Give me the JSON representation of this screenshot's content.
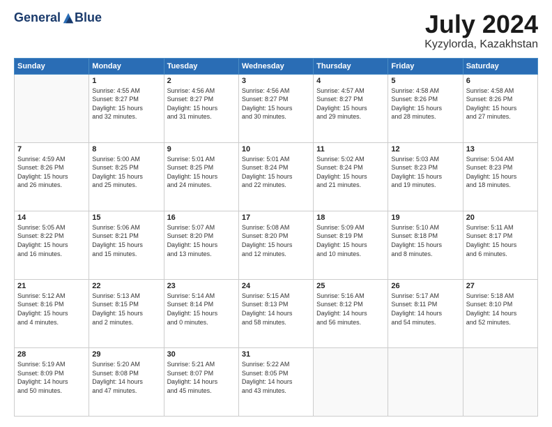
{
  "header": {
    "logo_general": "General",
    "logo_blue": "Blue",
    "title": "July 2024",
    "location": "Kyzylorda, Kazakhstan"
  },
  "days_of_week": [
    "Sunday",
    "Monday",
    "Tuesday",
    "Wednesday",
    "Thursday",
    "Friday",
    "Saturday"
  ],
  "weeks": [
    [
      {
        "day": "",
        "text": ""
      },
      {
        "day": "1",
        "text": "Sunrise: 4:55 AM\nSunset: 8:27 PM\nDaylight: 15 hours\nand 32 minutes."
      },
      {
        "day": "2",
        "text": "Sunrise: 4:56 AM\nSunset: 8:27 PM\nDaylight: 15 hours\nand 31 minutes."
      },
      {
        "day": "3",
        "text": "Sunrise: 4:56 AM\nSunset: 8:27 PM\nDaylight: 15 hours\nand 30 minutes."
      },
      {
        "day": "4",
        "text": "Sunrise: 4:57 AM\nSunset: 8:27 PM\nDaylight: 15 hours\nand 29 minutes."
      },
      {
        "day": "5",
        "text": "Sunrise: 4:58 AM\nSunset: 8:26 PM\nDaylight: 15 hours\nand 28 minutes."
      },
      {
        "day": "6",
        "text": "Sunrise: 4:58 AM\nSunset: 8:26 PM\nDaylight: 15 hours\nand 27 minutes."
      }
    ],
    [
      {
        "day": "7",
        "text": "Sunrise: 4:59 AM\nSunset: 8:26 PM\nDaylight: 15 hours\nand 26 minutes."
      },
      {
        "day": "8",
        "text": "Sunrise: 5:00 AM\nSunset: 8:25 PM\nDaylight: 15 hours\nand 25 minutes."
      },
      {
        "day": "9",
        "text": "Sunrise: 5:01 AM\nSunset: 8:25 PM\nDaylight: 15 hours\nand 24 minutes."
      },
      {
        "day": "10",
        "text": "Sunrise: 5:01 AM\nSunset: 8:24 PM\nDaylight: 15 hours\nand 22 minutes."
      },
      {
        "day": "11",
        "text": "Sunrise: 5:02 AM\nSunset: 8:24 PM\nDaylight: 15 hours\nand 21 minutes."
      },
      {
        "day": "12",
        "text": "Sunrise: 5:03 AM\nSunset: 8:23 PM\nDaylight: 15 hours\nand 19 minutes."
      },
      {
        "day": "13",
        "text": "Sunrise: 5:04 AM\nSunset: 8:23 PM\nDaylight: 15 hours\nand 18 minutes."
      }
    ],
    [
      {
        "day": "14",
        "text": "Sunrise: 5:05 AM\nSunset: 8:22 PM\nDaylight: 15 hours\nand 16 minutes."
      },
      {
        "day": "15",
        "text": "Sunrise: 5:06 AM\nSunset: 8:21 PM\nDaylight: 15 hours\nand 15 minutes."
      },
      {
        "day": "16",
        "text": "Sunrise: 5:07 AM\nSunset: 8:20 PM\nDaylight: 15 hours\nand 13 minutes."
      },
      {
        "day": "17",
        "text": "Sunrise: 5:08 AM\nSunset: 8:20 PM\nDaylight: 15 hours\nand 12 minutes."
      },
      {
        "day": "18",
        "text": "Sunrise: 5:09 AM\nSunset: 8:19 PM\nDaylight: 15 hours\nand 10 minutes."
      },
      {
        "day": "19",
        "text": "Sunrise: 5:10 AM\nSunset: 8:18 PM\nDaylight: 15 hours\nand 8 minutes."
      },
      {
        "day": "20",
        "text": "Sunrise: 5:11 AM\nSunset: 8:17 PM\nDaylight: 15 hours\nand 6 minutes."
      }
    ],
    [
      {
        "day": "21",
        "text": "Sunrise: 5:12 AM\nSunset: 8:16 PM\nDaylight: 15 hours\nand 4 minutes."
      },
      {
        "day": "22",
        "text": "Sunrise: 5:13 AM\nSunset: 8:15 PM\nDaylight: 15 hours\nand 2 minutes."
      },
      {
        "day": "23",
        "text": "Sunrise: 5:14 AM\nSunset: 8:14 PM\nDaylight: 15 hours\nand 0 minutes."
      },
      {
        "day": "24",
        "text": "Sunrise: 5:15 AM\nSunset: 8:13 PM\nDaylight: 14 hours\nand 58 minutes."
      },
      {
        "day": "25",
        "text": "Sunrise: 5:16 AM\nSunset: 8:12 PM\nDaylight: 14 hours\nand 56 minutes."
      },
      {
        "day": "26",
        "text": "Sunrise: 5:17 AM\nSunset: 8:11 PM\nDaylight: 14 hours\nand 54 minutes."
      },
      {
        "day": "27",
        "text": "Sunrise: 5:18 AM\nSunset: 8:10 PM\nDaylight: 14 hours\nand 52 minutes."
      }
    ],
    [
      {
        "day": "28",
        "text": "Sunrise: 5:19 AM\nSunset: 8:09 PM\nDaylight: 14 hours\nand 50 minutes."
      },
      {
        "day": "29",
        "text": "Sunrise: 5:20 AM\nSunset: 8:08 PM\nDaylight: 14 hours\nand 47 minutes."
      },
      {
        "day": "30",
        "text": "Sunrise: 5:21 AM\nSunset: 8:07 PM\nDaylight: 14 hours\nand 45 minutes."
      },
      {
        "day": "31",
        "text": "Sunrise: 5:22 AM\nSunset: 8:05 PM\nDaylight: 14 hours\nand 43 minutes."
      },
      {
        "day": "",
        "text": ""
      },
      {
        "day": "",
        "text": ""
      },
      {
        "day": "",
        "text": ""
      }
    ]
  ]
}
